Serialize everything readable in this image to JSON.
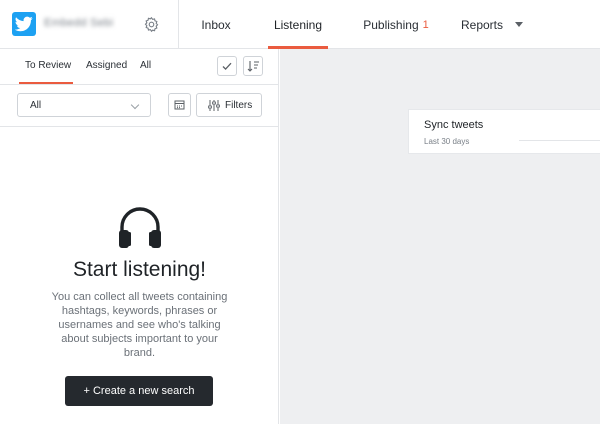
{
  "colors": {
    "accent": "#ea5b3f",
    "twitter": "#1da1f2",
    "dark_button": "#25292e"
  },
  "account": {
    "name": "Embedd Sebi",
    "logo_icon": "twitter-bird-icon",
    "settings_icon": "gear-icon"
  },
  "nav": {
    "tabs": [
      {
        "label": "Inbox"
      },
      {
        "label": "Listening",
        "active": true
      },
      {
        "label": "Publishing",
        "badge": "1"
      },
      {
        "label": "Reports",
        "dropdown": true
      }
    ]
  },
  "subtabs": {
    "items": [
      {
        "label": "To Review",
        "active": true
      },
      {
        "label": "Assigned"
      },
      {
        "label": "All"
      }
    ],
    "check_icon": "check-icon",
    "sort_icon": "sort-icon"
  },
  "filters": {
    "select_value": "All",
    "calendar_icon": "calendar-icon",
    "filters_label": "Filters",
    "filters_icon": "sliders-icon"
  },
  "empty_state": {
    "icon": "headphones-icon",
    "title": "Start listening!",
    "text": "You can collect all tweets containing hashtags, keywords, phrases or usernames and see who's talking about subjects important to your brand.",
    "button_label": "+ Create a new search"
  },
  "sync_card": {
    "title": "Sync tweets",
    "subtitle": "Last 30 days"
  }
}
